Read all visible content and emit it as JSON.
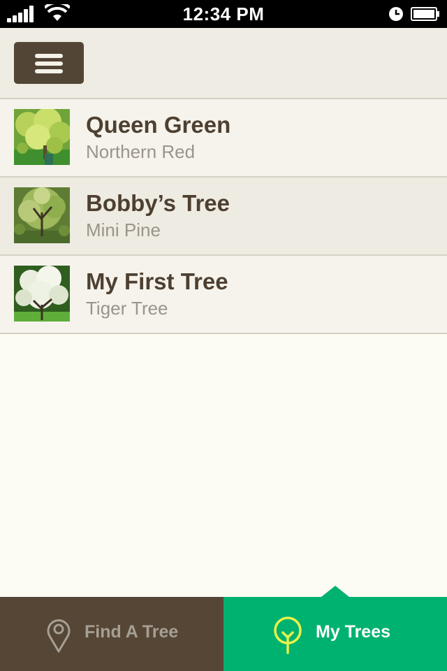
{
  "status_bar": {
    "time": "12:34 PM",
    "icons": [
      "signal-icon",
      "wifi-icon",
      "alarm-icon",
      "battery-icon"
    ]
  },
  "header": {
    "menu_icon": "hamburger-menu-icon"
  },
  "trees": [
    {
      "name": "Queen Green",
      "species": "Northern Red",
      "thumbnail": "tree-photo-yellow-green"
    },
    {
      "name": "Bobby’s Tree",
      "species": "Mini Pine",
      "thumbnail": "tree-photo-weeping"
    },
    {
      "name": "My First Tree",
      "species": "Tiger Tree",
      "thumbnail": "tree-photo-white-blossom"
    }
  ],
  "tab_bar": {
    "tabs": [
      {
        "label": "Find A Tree",
        "icon": "map-pin-icon",
        "active": false
      },
      {
        "label": "My Trees",
        "icon": "tree-icon",
        "active": true
      }
    ]
  },
  "colors": {
    "brown": "#534535",
    "green": "#00B26F",
    "background": "#FDFCF3",
    "title_text": "#4E4031",
    "subtitle_text": "#9B948A",
    "active_icon": "#E8F24A"
  }
}
